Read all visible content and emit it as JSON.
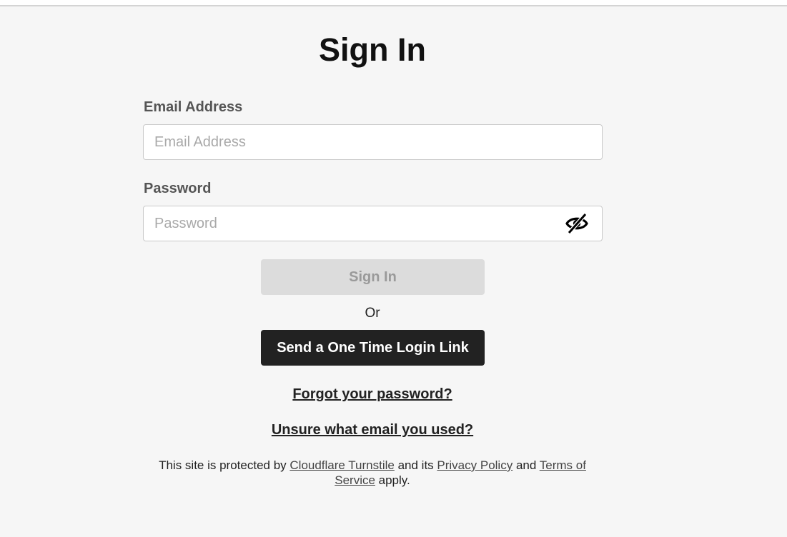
{
  "header": {
    "title": "Sign In"
  },
  "form": {
    "email": {
      "label": "Email Address",
      "value": "",
      "placeholder": "Email Address"
    },
    "password": {
      "label": "Password",
      "value": "",
      "placeholder": "Password",
      "toggle_icon": "eye-off-icon"
    },
    "signin_button": "Sign In",
    "or_text": "Or",
    "one_time_link_button": "Send a One Time Login Link"
  },
  "links": {
    "forgot_password": "Forgot your password?",
    "unsure_email": "Unsure what email you used?"
  },
  "legal": {
    "prefix": "This site is protected by ",
    "turnstile": "Cloudflare Turnstile",
    "middle": " and its ",
    "privacy": "Privacy Policy",
    "and": " and ",
    "terms": "Terms of Service",
    "suffix": " apply."
  },
  "colors": {
    "background": "#f6f6f6",
    "primary_button": "#222222",
    "disabled_button": "#dcdcdc",
    "disabled_text": "#9a9a9a",
    "label": "#555555"
  }
}
